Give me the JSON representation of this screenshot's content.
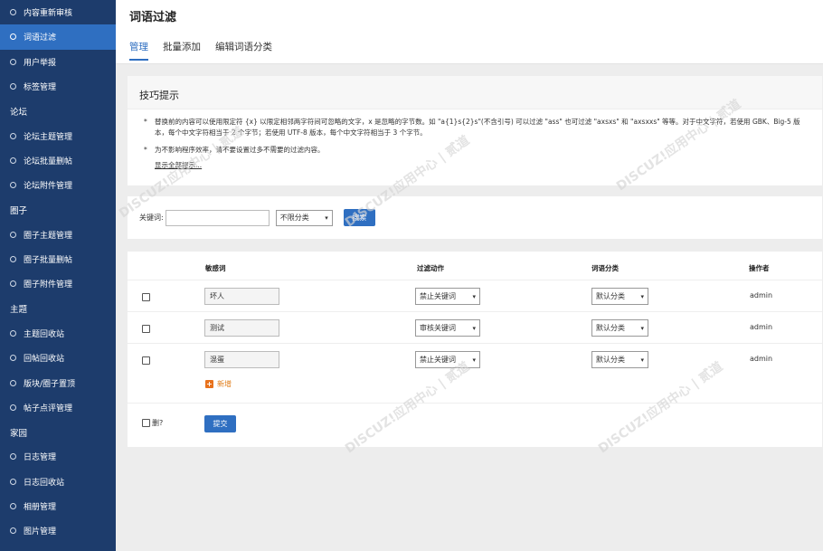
{
  "sidebar": {
    "items": [
      {
        "type": "item",
        "label": "内容重新审核"
      },
      {
        "type": "item",
        "label": "词语过滤",
        "active": true
      },
      {
        "type": "item",
        "label": "用户举报"
      },
      {
        "type": "item",
        "label": "标签管理"
      },
      {
        "type": "group",
        "label": "论坛"
      },
      {
        "type": "item",
        "label": "论坛主题管理"
      },
      {
        "type": "item",
        "label": "论坛批量删帖"
      },
      {
        "type": "item",
        "label": "论坛附件管理"
      },
      {
        "type": "group",
        "label": "圈子"
      },
      {
        "type": "item",
        "label": "圈子主题管理"
      },
      {
        "type": "item",
        "label": "圈子批量删帖"
      },
      {
        "type": "item",
        "label": "圈子附件管理"
      },
      {
        "type": "group",
        "label": "主题"
      },
      {
        "type": "item",
        "label": "主题回收站"
      },
      {
        "type": "item",
        "label": "回帖回收站"
      },
      {
        "type": "item",
        "label": "版块/圈子置顶"
      },
      {
        "type": "item",
        "label": "帖子点评管理"
      },
      {
        "type": "group",
        "label": "家园"
      },
      {
        "type": "item",
        "label": "日志管理"
      },
      {
        "type": "item",
        "label": "日志回收站"
      },
      {
        "type": "item",
        "label": "相册管理"
      },
      {
        "type": "item",
        "label": "图片管理"
      }
    ]
  },
  "header": {
    "title": "词语过滤",
    "tabs": [
      "管理",
      "批量添加",
      "编辑词语分类"
    ]
  },
  "tips": {
    "title": "技巧提示",
    "line1": "替换前的内容可以使用限定符 {x} 以限定相邻两字符间可忽略的文字，x 是忽略的字节数。如 \"a{1}s{2}s\"(不含引号) 可以过滤 \"ass\" 也可过滤 \"axsxs\" 和 \"axsxxs\" 等等。对于中文字符，若使用 GBK、Big-5 版本，每个中文字符相当于 2 个字节；若使用 UTF-8 版本，每个中文字符相当于 3 个字节。",
    "line2": "为不影响程序效率，请不要设置过多不需要的过滤内容。",
    "show_all": "显示全部提示..."
  },
  "search": {
    "label": "关键词:",
    "keyword_value": "",
    "category_select": "不限分类",
    "submit": "搜索"
  },
  "table": {
    "headers": [
      "敏感词",
      "过滤动作",
      "词语分类",
      "操作者"
    ],
    "rows": [
      {
        "word": "坏人",
        "action": "禁止关键词",
        "category": "默认分类",
        "operator": "admin"
      },
      {
        "word": "测试",
        "action": "审核关键词",
        "category": "默认分类",
        "operator": "admin"
      },
      {
        "word": "混蛋",
        "action": "禁止关键词",
        "category": "默认分类",
        "operator": "admin"
      }
    ],
    "add_new": "新增",
    "delete_label": "删?",
    "submit": "提交"
  },
  "colors": {
    "sidebar_bg": "#1d3c6c",
    "sidebar_active": "#2f6fc1",
    "accent": "#2f6fc1",
    "add_orange": "#e8711b"
  }
}
